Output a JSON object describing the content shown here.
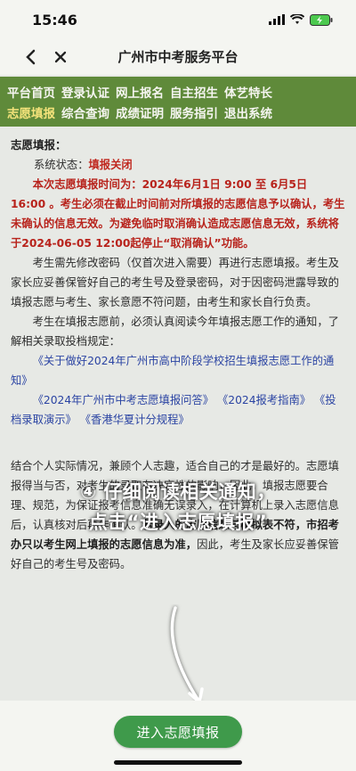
{
  "status_bar": {
    "time": "15:46"
  },
  "nav": {
    "title": "广州市中考服务平台"
  },
  "menu": {
    "row1": [
      "平台首页",
      "登录认证",
      "网上报名",
      "自主招生",
      "体艺特长"
    ],
    "row2": [
      "志愿填报",
      "综合查询",
      "成绩证明",
      "服务指引",
      "退出系统"
    ]
  },
  "content": {
    "section_title": "志愿填报：",
    "status_label": "系统状态：",
    "status_value": "填报关闭",
    "warning": "本次志愿填报时间为：2024年6月1日 9:00 至 6月5日 16:00 。考生必须在截止时间前对所填报的志愿信息予以确认，考生未确认的信息无效。为避免临时取消确认造成志愿信息无效，系统将于2024-06-05 12:00起停止“取消确认”功能。",
    "para1": "考生需先修改密码（仅首次进入需要）再进行志愿填报。考生及家长应妥善保管好自己的考生号及登录密码，对于因密码泄露导致的填报志愿与考生、家长意愿不符问题，由考生和家长自行负责。",
    "para2": "考生在填报志愿前，必须认真阅读今年填报志愿工作的通知，了解相关录取投档规定：",
    "link1": "《关于做好2024年广州市高中阶段学校招生填报志愿工作的通知》",
    "link2": "《2024年广州市中考志愿填报问答》",
    "link3": "《2024报考指南》",
    "link4": "《投档录取演示》",
    "link5": "《香港华夏计分规程》",
    "para3_visible": "结合个人实际情况，兼顾个人志趣，适合自己的才是最好的。志愿填报得当与否，对考生的录取有决定性的影响，因此，填报志愿要合理、规范，为保证报考信息准确无误录入，在计算机上录入志愿信息后，认真核对后再作确认。",
    "para3_bold": "若录入的志愿信息与模拟表不符，市招考办只以考生网上填报的志愿信息为准，",
    "para3_tail": "因此，考生及家长应妥善保管好自己的考生号及密码。"
  },
  "overlay": {
    "line1": "④ 仔细阅读相关通知，",
    "line2": "点击“进入志愿填报”"
  },
  "button": {
    "label": "进入志愿填报"
  },
  "colors": {
    "menu_bg": "#5f8a3a",
    "menu_active": "#f3e27a",
    "warning": "#b8231c",
    "link": "#2b44a3",
    "button": "#3f9a4b"
  }
}
